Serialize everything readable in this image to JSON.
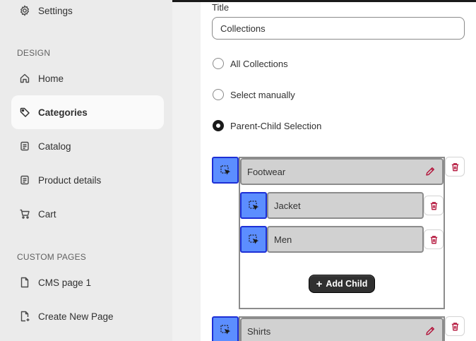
{
  "sidebar": {
    "settings_label": "Settings",
    "design_section": "DESIGN",
    "items": [
      {
        "label": "Home",
        "icon": "home-icon"
      },
      {
        "label": "Categories",
        "icon": "tag-icon",
        "active": true
      },
      {
        "label": "Catalog",
        "icon": "catalog-icon"
      },
      {
        "label": "Product details",
        "icon": "product-details-icon"
      },
      {
        "label": "Cart",
        "icon": "cart-icon"
      }
    ],
    "custom_pages_section": "CUSTOM PAGES",
    "pages": [
      {
        "label": "CMS page 1",
        "icon": "page-icon"
      },
      {
        "label": "Create New Page",
        "icon": "page-add-icon"
      }
    ]
  },
  "form": {
    "title_label": "Title",
    "title_value": "Collections",
    "options": [
      {
        "label": "All Collections",
        "checked": false
      },
      {
        "label": "Select manually",
        "checked": false
      },
      {
        "label": "Parent-Child Selection",
        "checked": true
      }
    ]
  },
  "tree": {
    "parents": [
      {
        "label": "Footwear",
        "children": [
          {
            "label": "Jacket"
          },
          {
            "label": "Men"
          }
        ]
      },
      {
        "label": "Shirts",
        "children": []
      }
    ],
    "add_child_label": "Add Child"
  },
  "colors": {
    "drag_fill": "#5c8eff",
    "drag_border": "#1d2fd6",
    "delete_icon": "#b3133a",
    "sidebar_bg": "#ebebeb"
  }
}
